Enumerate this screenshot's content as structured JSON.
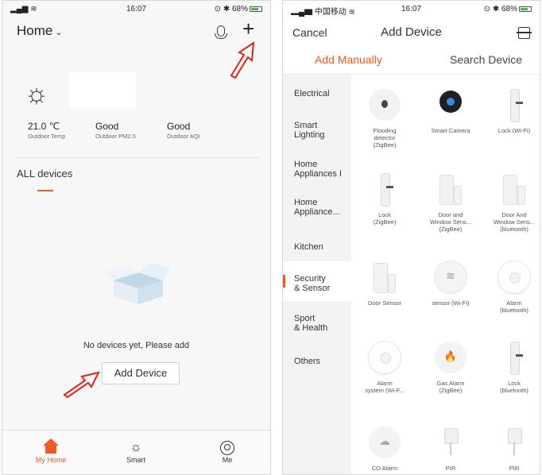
{
  "left": {
    "status": {
      "time": "16:07",
      "battery": "68%"
    },
    "header": {
      "title": "Home",
      "chevron": "chevron-down-icon",
      "mic": "mic-icon",
      "add": "+"
    },
    "weather": {
      "sun": "☼",
      "metrics": [
        {
          "value": "21.0 ℃",
          "label": "Outdoor Temp"
        },
        {
          "value": "Good",
          "label": "Outdoor PM2.5"
        },
        {
          "value": "Good",
          "label": "Outdoor AQI"
        }
      ]
    },
    "tab": "ALL devices",
    "empty": {
      "message": "No devices yet, Please add",
      "button": "Add Device"
    },
    "nav": [
      {
        "label": "My Home",
        "icon": "home-icon"
      },
      {
        "label": "Smart",
        "icon": "sun-icon"
      },
      {
        "label": "Me",
        "icon": "profile-icon"
      }
    ],
    "accent": "#ee5a24"
  },
  "right": {
    "status": {
      "carrier": "中国移动",
      "time": "16:07",
      "battery": "68%"
    },
    "header": {
      "cancel": "Cancel",
      "title": "Add Device",
      "scan": "scan-icon"
    },
    "tabs": [
      "Add Manually",
      "Search Device"
    ],
    "categories": [
      "Electrical",
      "Smart\nLighting",
      "Home\nAppliances I",
      "Home\nAppliance...",
      "Kitchen",
      "Security\n& Sensor",
      "Sport\n& Health",
      "Others"
    ],
    "selected_category": "Security\n& Sensor",
    "devices": [
      {
        "label": "Flooding\ndetector\n(ZigBee)",
        "icon": "water-drop-icon"
      },
      {
        "label": "Smart Camera",
        "icon": "camera-icon"
      },
      {
        "label": "Lock (Wi-Fi)",
        "icon": "lock-icon"
      },
      {
        "label": "Lock\n(ZigBee)",
        "icon": "lock-icon"
      },
      {
        "label": "Door and\nWindow Sens...\n(ZigBee)",
        "icon": "door-sensor-icon"
      },
      {
        "label": "Door And\nWindow Sens...\n(bluetooth)",
        "icon": "door-sensor-icon"
      },
      {
        "label": "Door Sensor",
        "icon": "door-sensor-icon"
      },
      {
        "label": "sensor (Wi-Fi)",
        "icon": "wave-icon"
      },
      {
        "label": "Alarm\n(bluetooth)",
        "icon": "alarm-icon"
      },
      {
        "label": "Alarm\nsystem (Wi-F...",
        "icon": "alarm-icon"
      },
      {
        "label": "Gas Alarm\n(ZigBee)",
        "icon": "flame-icon"
      },
      {
        "label": "Lock\n(bluetooth)",
        "icon": "lock-icon"
      },
      {
        "label": "CO Alarm",
        "icon": "co-icon"
      },
      {
        "label": "PIR",
        "icon": "pir-icon"
      },
      {
        "label": "PIR",
        "icon": "pir-icon"
      }
    ]
  }
}
